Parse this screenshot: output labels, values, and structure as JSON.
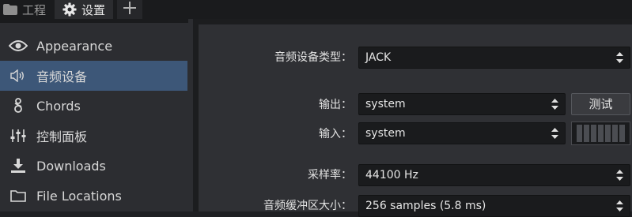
{
  "tabs": [
    {
      "label": "工程",
      "icon": "folder-icon"
    },
    {
      "label": "设置",
      "icon": "gear-icon"
    }
  ],
  "add_tab_icon": "plus-icon",
  "sidebar": {
    "items": [
      {
        "label": "Appearance",
        "icon": "eye-icon"
      },
      {
        "label": "音频设备",
        "icon": "speaker-icon",
        "selected": true
      },
      {
        "label": "Chords",
        "icon": "music-note-icon"
      },
      {
        "label": "控制面板",
        "icon": "sliders-icon"
      },
      {
        "label": "Downloads",
        "icon": "download-icon"
      },
      {
        "label": "File Locations",
        "icon": "folder-outline-icon"
      }
    ]
  },
  "audio": {
    "device_type_label": "音频设备类型：",
    "device_type_value": "JACK",
    "output_label": "输出：",
    "output_value": "system",
    "test_button": "测试",
    "input_label": "输入：",
    "input_value": "system",
    "sample_rate_label": "采样率：",
    "sample_rate_value": "44100 Hz",
    "buffer_label": "音频缓冲区大小：",
    "buffer_value": "256 samples (5.8 ms)"
  },
  "colors": {
    "selected_bg": "#3d5778",
    "panel_bg": "#2f3034",
    "sidebar_bg": "#2c2d31"
  }
}
